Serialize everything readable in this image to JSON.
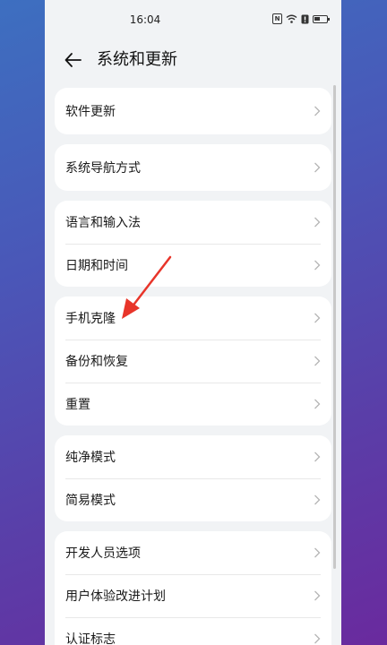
{
  "status_bar": {
    "time": "16:04",
    "icons": [
      "nfc-icon",
      "wifi-icon",
      "alert-icon",
      "battery-icon"
    ]
  },
  "header": {
    "title": "系统和更新",
    "back_icon": "arrow-left-icon"
  },
  "groups": [
    {
      "items": [
        {
          "label": "软件更新"
        }
      ]
    },
    {
      "items": [
        {
          "label": "系统导航方式"
        }
      ]
    },
    {
      "items": [
        {
          "label": "语言和输入法"
        },
        {
          "label": "日期和时间"
        }
      ]
    },
    {
      "items": [
        {
          "label": "手机克隆"
        },
        {
          "label": "备份和恢复"
        },
        {
          "label": "重置"
        }
      ]
    },
    {
      "items": [
        {
          "label": "纯净模式"
        },
        {
          "label": "简易模式"
        }
      ]
    },
    {
      "items": [
        {
          "label": "开发人员选项"
        },
        {
          "label": "用户体验改进计划"
        },
        {
          "label": "认证标志"
        }
      ]
    }
  ],
  "colors": {
    "annotation_arrow": "#e8352a",
    "background": "#f1f3f5",
    "card": "#ffffff"
  }
}
